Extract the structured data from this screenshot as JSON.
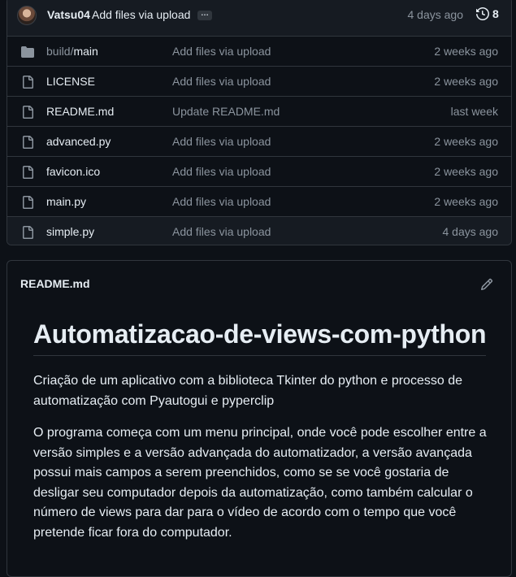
{
  "commit": {
    "author": "Vatsu04",
    "message": "Add files via upload",
    "ellipsis": "…",
    "time": "4 days ago",
    "history_count": "8"
  },
  "files": [
    {
      "type": "folder",
      "icon": "folder-icon",
      "dir": "build/",
      "name": "main",
      "commit": "Add files via upload",
      "time": "2 weeks ago"
    },
    {
      "type": "file",
      "icon": "file-icon",
      "dir": "",
      "name": "LICENSE",
      "commit": "Add files via upload",
      "time": "2 weeks ago"
    },
    {
      "type": "file",
      "icon": "file-icon",
      "dir": "",
      "name": "README.md",
      "commit": "Update README.md",
      "time": "last week"
    },
    {
      "type": "file",
      "icon": "file-icon",
      "dir": "",
      "name": "advanced.py",
      "commit": "Add files via upload",
      "time": "2 weeks ago"
    },
    {
      "type": "file",
      "icon": "file-icon",
      "dir": "",
      "name": "favicon.ico",
      "commit": "Add files via upload",
      "time": "2 weeks ago"
    },
    {
      "type": "file",
      "icon": "file-icon",
      "dir": "",
      "name": "main.py",
      "commit": "Add files via upload",
      "time": "2 weeks ago"
    },
    {
      "type": "file",
      "icon": "file-icon",
      "dir": "",
      "name": "simple.py",
      "commit": "Add files via upload",
      "time": "4 days ago"
    }
  ],
  "readme": {
    "filename": "README.md",
    "heading": "Automatizacao-de-views-com-python",
    "paragraph1": "Criação de um aplicativo com a biblioteca Tkinter do python e processo de automatização com Pyautogui e pyperclip",
    "paragraph2": "O programa começa com um menu principal, onde você pode escolher entre a versão simples e a versão advançada do automatizador, a versão avançada possui mais campos a serem preenchidos, como se se você gostaria de desligar seu computador depois da automatização, como também calcular o número de views para dar para o vídeo de acordo com o tempo que você pretende ficar fora do computador."
  },
  "colors": {
    "background": "#0d1117",
    "surface": "#161b22",
    "border": "#30363d",
    "text": "#e6edf3",
    "muted": "#8b949e",
    "icon": "#8b949e"
  }
}
